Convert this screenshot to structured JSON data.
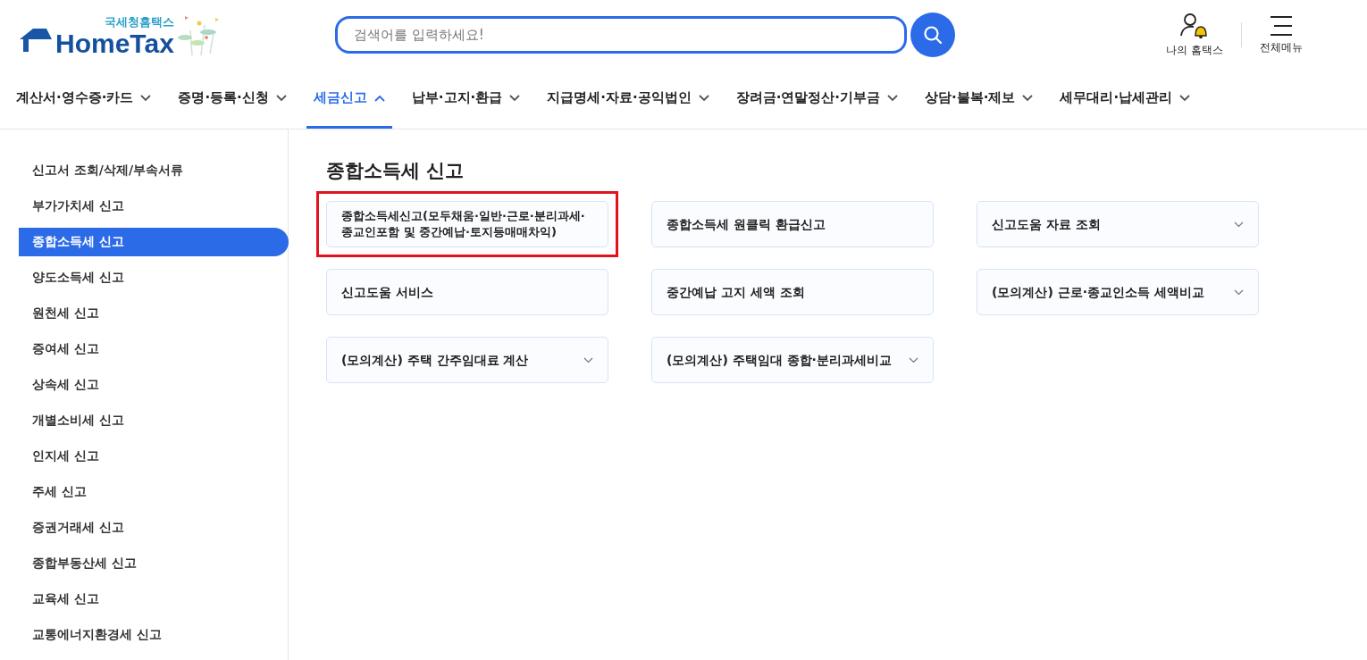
{
  "header": {
    "logo": {
      "subtitle": "국세청홈택스",
      "title": "HomeTax"
    },
    "search": {
      "placeholder": "검색어를 입력하세요!"
    },
    "actions": [
      {
        "kind": "user",
        "label": "나의 홈택스"
      },
      {
        "kind": "menu",
        "label": "전체메뉴"
      }
    ]
  },
  "nav": [
    {
      "label": "계산서·영수증·카드",
      "selected": false
    },
    {
      "label": "증명·등록·신청",
      "selected": false
    },
    {
      "label": "세금신고",
      "selected": true
    },
    {
      "label": "납부·고지·환급",
      "selected": false
    },
    {
      "label": "지급명세·자료·공익법인",
      "selected": false
    },
    {
      "label": "장려금·연말정산·기부금",
      "selected": false
    },
    {
      "label": "상담·불복·제보",
      "selected": false
    },
    {
      "label": "세무대리·납세관리",
      "selected": false
    }
  ],
  "sidebar": {
    "items": [
      {
        "label": "신고서 조회/삭제/부속서류",
        "selected": false
      },
      {
        "label": "부가가치세 신고",
        "selected": false
      },
      {
        "label": "종합소득세 신고",
        "selected": true
      },
      {
        "label": "양도소득세 신고",
        "selected": false
      },
      {
        "label": "원천세 신고",
        "selected": false
      },
      {
        "label": "증여세 신고",
        "selected": false
      },
      {
        "label": "상속세 신고",
        "selected": false
      },
      {
        "label": "개별소비세 신고",
        "selected": false
      },
      {
        "label": "인지세 신고",
        "selected": false
      },
      {
        "label": "주세 신고",
        "selected": false
      },
      {
        "label": "증권거래세 신고",
        "selected": false
      },
      {
        "label": "종합부동산세 신고",
        "selected": false
      },
      {
        "label": "교육세 신고",
        "selected": false
      },
      {
        "label": "교통에너지환경세 신고",
        "selected": false
      }
    ]
  },
  "content": {
    "title": "종합소득세 신고",
    "cards": [
      {
        "kind": "link",
        "label": "종합소득세신고(모두채움·일반·근로·분리과세·종교인포함 및 중간예납·토지등매매차익)",
        "highlighted": true
      },
      {
        "kind": "link",
        "label": "종합소득세 원클릭 환급신고",
        "highlighted": false
      },
      {
        "kind": "dropdown",
        "label": "신고도움 자료 조회",
        "highlighted": false
      },
      {
        "kind": "link",
        "label": "신고도움 서비스",
        "highlighted": false
      },
      {
        "kind": "link",
        "label": "중간예납 고지 세액 조회",
        "highlighted": false
      },
      {
        "kind": "dropdown",
        "label": "(모의계산) 근로·종교인소득 세액비교",
        "highlighted": false
      },
      {
        "kind": "dropdown",
        "label": "(모의계산) 주택 간주임대료 계산",
        "highlighted": false
      },
      {
        "kind": "dropdown",
        "label": "(모의계산) 주택임대 종합·분리과세비교",
        "highlighted": false
      }
    ]
  }
}
